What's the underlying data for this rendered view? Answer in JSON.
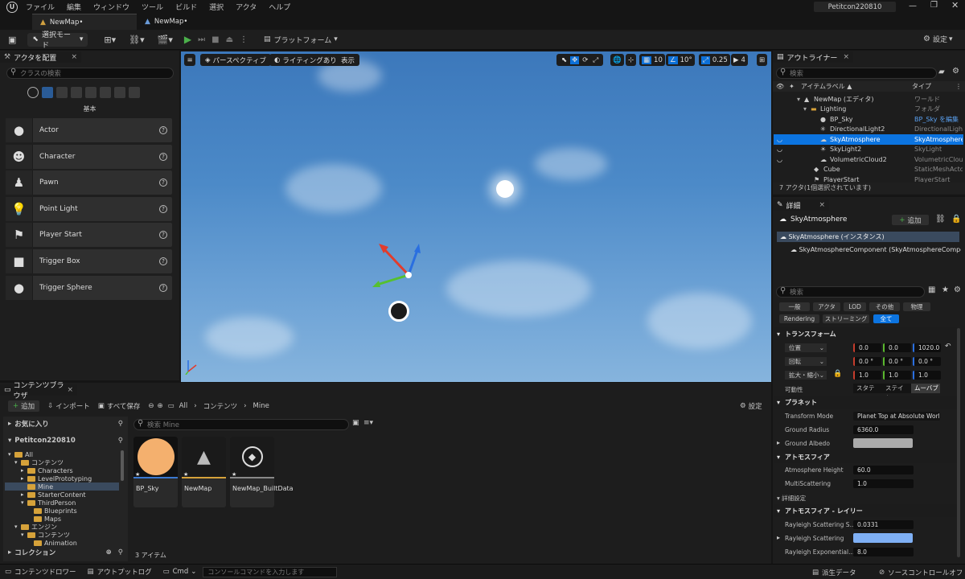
{
  "menu": [
    "ファイル",
    "編集",
    "ウィンドウ",
    "ツール",
    "ビルド",
    "選択",
    "アクタ",
    "ヘルプ"
  ],
  "project_name": "Petitcon220810",
  "tabs": [
    "NewMap•",
    "NewMap•"
  ],
  "toolbar": {
    "select_mode": "選択モード",
    "platform": "プラットフォーム",
    "settings": "設定"
  },
  "place_actors": {
    "tab": "アクタを配置",
    "search_placeholder": "クラスの検索",
    "category": "基本",
    "items": [
      {
        "label": "Actor",
        "icon": "sphere-icon"
      },
      {
        "label": "Character",
        "icon": "character-icon"
      },
      {
        "label": "Pawn",
        "icon": "pawn-icon"
      },
      {
        "label": "Point Light",
        "icon": "lightbulb-icon"
      },
      {
        "label": "Player Start",
        "icon": "flag-icon"
      },
      {
        "label": "Trigger Box",
        "icon": "box-icon"
      },
      {
        "label": "Trigger Sphere",
        "icon": "sphere-icon"
      }
    ]
  },
  "viewport": {
    "perspective": "パースペクティブ",
    "lighting": "ライティングあり",
    "show": "表示",
    "grid": "10",
    "angle": "10°",
    "scale": "0.25",
    "camera_speed": "4"
  },
  "outliner": {
    "tab": "アウトライナー",
    "search_placeholder": "検索",
    "col_label": "アイテムラベル ▲",
    "col_type": "タイプ",
    "rows": [
      {
        "name": "NewMap (エディタ)",
        "type": "ワールド"
      },
      {
        "name": "Lighting",
        "type": "フォルダ"
      },
      {
        "name": "BP_Sky",
        "type": "BP_Sky を編集"
      },
      {
        "name": "DirectionalLight2",
        "type": "DirectionalLight"
      },
      {
        "name": "SkyAtmosphere",
        "type": "SkyAtmosphere"
      },
      {
        "name": "SkyLight2",
        "type": "SkyLight"
      },
      {
        "name": "VolumetricCloud2",
        "type": "VolumetricCloud"
      },
      {
        "name": "Cube",
        "type": "StaticMeshActor"
      },
      {
        "name": "PlayerStart",
        "type": "PlayerStart"
      }
    ],
    "status": "7 アクタ(1個選択されています)"
  },
  "details": {
    "tab": "詳細",
    "title": "SkyAtmosphere",
    "add": "追加",
    "instance": "SkyAtmosphere (インスタンス)",
    "component": "SkyAtmosphereComponent (SkyAtmosphereComponent)",
    "search_placeholder": "検索",
    "categories": [
      "一般",
      "アクタ",
      "LOD",
      "その他",
      "物理",
      "Rendering",
      "ストリーミング",
      "全て"
    ],
    "transform": {
      "header": "トランスフォーム",
      "location": {
        "label": "位置",
        "x": "0.0",
        "y": "0.0",
        "z": "1020.0"
      },
      "rotation": {
        "label": "回転",
        "x": "0.0 °",
        "y": "0.0 °",
        "z": "0.0 °"
      },
      "scale": {
        "label": "拡大・縮小",
        "x": "1.0",
        "y": "1.0",
        "z": "1.0"
      },
      "mobility": {
        "label": "可動性",
        "options": [
          "スタティ:",
          "ステイシ:",
          "ムーバブ"
        ]
      }
    },
    "planet": {
      "header": "プラネット",
      "transform_mode_label": "Transform Mode",
      "transform_mode": "Planet Top at Absolute World",
      "ground_radius_label": "Ground Radius",
      "ground_radius": "6360.0",
      "ground_albedo_label": "Ground Albedo"
    },
    "atmosphere": {
      "header": "アトモスフィア",
      "height_label": "Atmosphere Height",
      "height": "60.0",
      "multi_label": "MultiScattering",
      "multi": "1.0",
      "advanced": "詳細設定"
    },
    "rayleigh": {
      "header": "アトモスフィア - レイリー",
      "s_label": "Rayleigh Scattering S...",
      "s": "0.0331",
      "scat_label": "Rayleigh Scattering",
      "exp_label": "Rayleigh Exponential...",
      "exp": "8.0"
    }
  },
  "content_browser": {
    "tab": "コンテンツブラウザ",
    "add": "追加",
    "import": "インポート",
    "save_all": "すべて保存",
    "path": [
      "All",
      "コンテンツ",
      "Mine"
    ],
    "settings": "設定",
    "favorites": "お気に入り",
    "project": "Petitcon220810",
    "search_placeholder": "検索 Mine",
    "tree": [
      "All",
      "コンテンツ",
      "Characters",
      "LevelPrototyping",
      "Mine",
      "StarterContent",
      "ThirdPerson",
      "Blueprints",
      "Maps",
      "エンジン",
      "コンテンツ",
      "Animation"
    ],
    "collections": "コレクション",
    "assets": [
      {
        "name": "BP_Sky"
      },
      {
        "name": "NewMap"
      },
      {
        "name": "NewMap_BuiltData"
      }
    ],
    "count": "3 アイテム"
  },
  "statusbar": {
    "drawer": "コンテンツドロワー",
    "output": "アウトプットログ",
    "cmd": "Cmd",
    "console_placeholder": "コンソールコマンドを入力します",
    "derived": "派生データ",
    "source_control": "ソースコントロールオフ"
  },
  "colors": {
    "accent": "#0d70d8",
    "selection": "#0c74e0",
    "play": "#4bb04b"
  }
}
